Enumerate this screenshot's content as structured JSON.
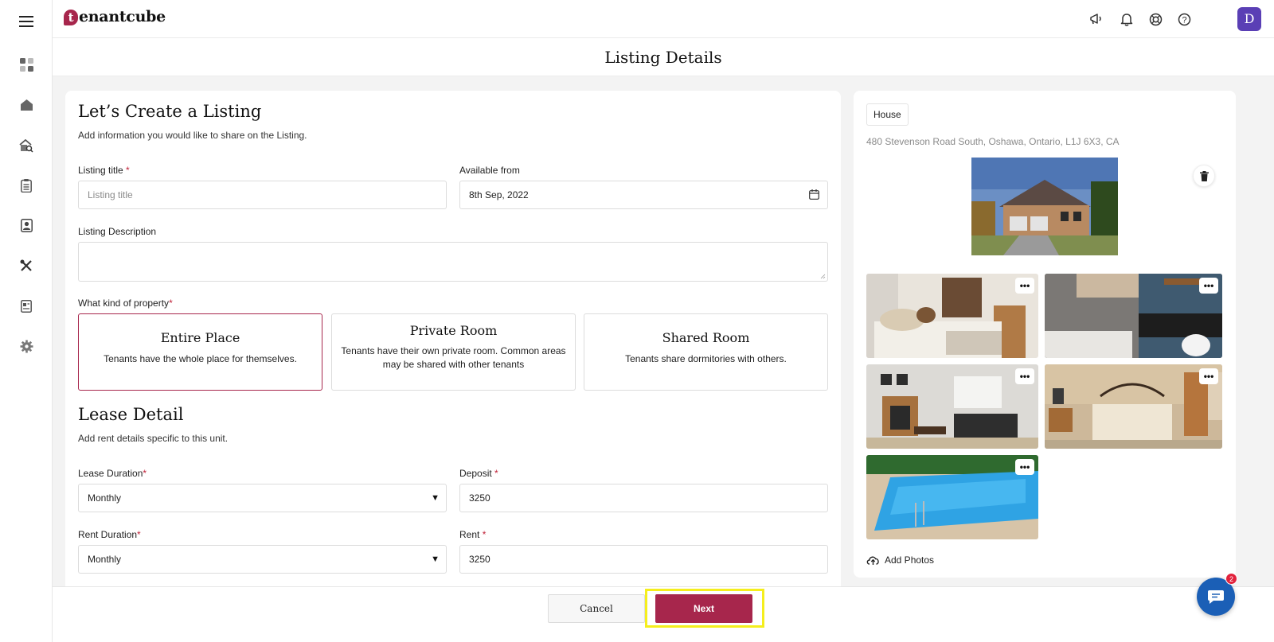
{
  "app": {
    "logo_letter": "t",
    "logo_rest": "enantcube",
    "avatar_initial": "D"
  },
  "page": {
    "title": "Listing Details"
  },
  "listing": {
    "heading": "Let’s Create a Listing",
    "subheading": "Add information you would like to share on the Listing.",
    "title_label": "Listing title",
    "title_placeholder": "Listing title",
    "available_label": "Available from",
    "available_value": "8th Sep, 2022",
    "description_label": "Listing Description",
    "description_value": "",
    "property_kind_label": "What kind of property",
    "property_types": [
      {
        "title": "Entire Place",
        "desc": "Tenants have the whole place for themselves.",
        "selected": true
      },
      {
        "title": "Private Room",
        "desc": "Tenants have their own private room. Common areas may be shared with other tenants",
        "selected": false
      },
      {
        "title": "Shared Room",
        "desc": "Tenants share dormitories with others.",
        "selected": false
      }
    ]
  },
  "lease": {
    "heading": "Lease Detail",
    "subheading": "Add rent details specific to this unit.",
    "lease_duration_label": "Lease Duration",
    "lease_duration_value": "Monthly",
    "deposit_label": "Deposit",
    "deposit_value": "3250",
    "rent_duration_label": "Rent Duration",
    "rent_duration_value": "Monthly",
    "rent_label": "Rent",
    "rent_value": "3250"
  },
  "property": {
    "type_tag": "House",
    "address": "480 Stevenson Road South, Oshawa, Ontario, L1J 6X3, CA",
    "add_photos_label": "Add Photos",
    "more_label": "•••"
  },
  "footer": {
    "cancel_label": "Cancel",
    "next_label": "Next"
  },
  "chat": {
    "badge_count": "2"
  },
  "colors": {
    "brand": "#a7264c",
    "avatar": "#5a3fb5",
    "chat": "#1b5fb6",
    "highlight": "#f5ee1d"
  }
}
